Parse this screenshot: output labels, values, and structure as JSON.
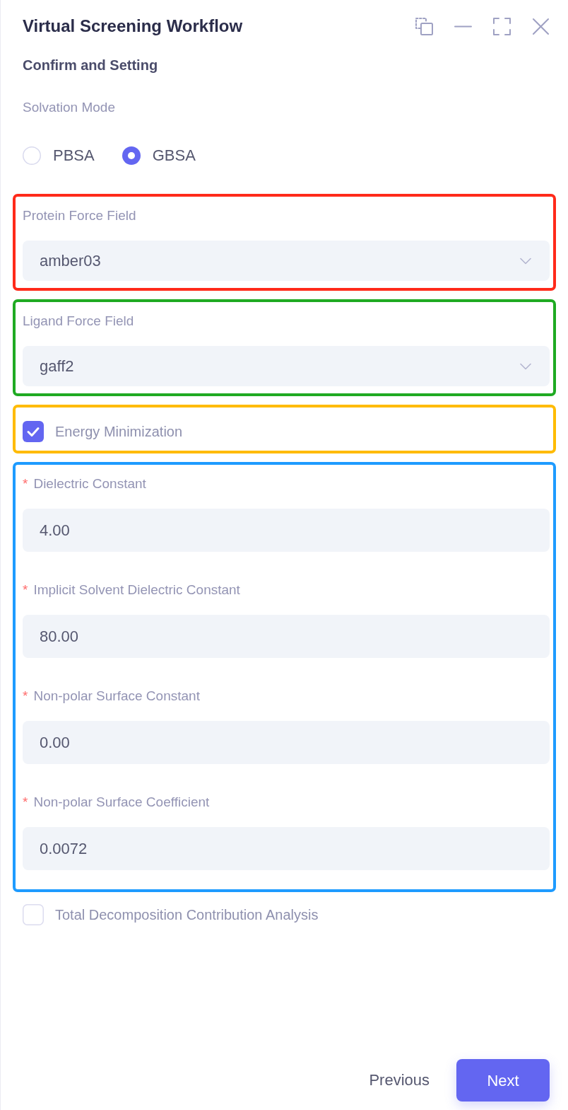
{
  "window": {
    "title": "Virtual Screening Workflow"
  },
  "step_title": "Confirm and Setting",
  "solvation_mode": {
    "label": "Solvation Mode",
    "options": [
      {
        "label": "PBSA",
        "selected": false
      },
      {
        "label": "GBSA",
        "selected": true
      }
    ]
  },
  "sections": [
    {
      "color": "#ff2a1a",
      "fields": [
        {
          "kind": "select",
          "label": "Protein Force Field",
          "value": "amber03"
        }
      ]
    },
    {
      "color": "#1faa22",
      "fields": [
        {
          "kind": "select",
          "label": "Ligand Force Field",
          "value": "gaff2"
        }
      ]
    },
    {
      "color": "#ffbb00",
      "fields": [
        {
          "kind": "checkbox",
          "label": "Energy Minimization",
          "checked": true
        }
      ]
    },
    {
      "color": "#1e9bff",
      "fields": [
        {
          "kind": "input",
          "required_mark": "*",
          "label": "Dielectric Constant",
          "value": "4.00"
        },
        {
          "kind": "input",
          "required_mark": "*",
          "label": "Implicit Solvent Dielectric Constant",
          "value": "80.00"
        },
        {
          "kind": "input",
          "required_mark": "*",
          "label": "Non-polar Surface Constant",
          "value": "0.00"
        },
        {
          "kind": "input",
          "required_mark": "*",
          "label": "Non-polar Surface Coefficient",
          "value": "0.0072"
        }
      ]
    }
  ],
  "decomposition": {
    "label": "Total Decomposition Contribution Analysis",
    "checked": false
  },
  "buttons": [
    {
      "kind": "secondary",
      "label": "Previous"
    },
    {
      "kind": "primary",
      "label": "Next"
    }
  ]
}
